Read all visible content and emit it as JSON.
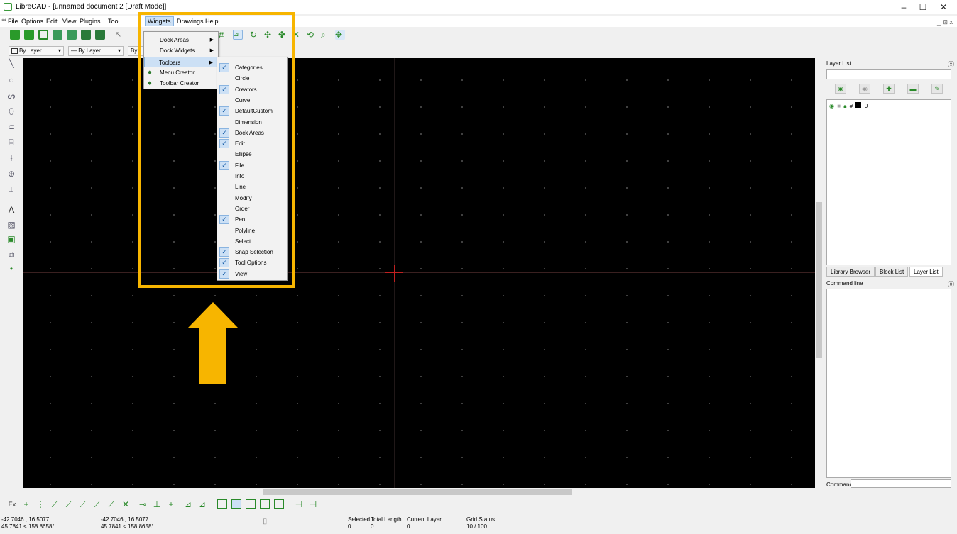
{
  "window": {
    "title": "LibreCAD - [unnamed document 2 [Draft Mode]]",
    "minimize": "–",
    "maximize": "☐",
    "close": "✕",
    "mdi_controls": "_ ⊡ x"
  },
  "menubar": {
    "items": [
      "File",
      "Options",
      "Edit",
      "View",
      "Plugins",
      "Tool",
      "Widgets",
      "Drawings",
      "Help"
    ]
  },
  "toolbar2": {
    "color_combo": "By Layer",
    "width_combo": "— By Layer",
    "type_combo": "By"
  },
  "widgets_menu": {
    "items": [
      {
        "label": "Dock Areas",
        "submenu": true
      },
      {
        "label": "Dock Widgets",
        "submenu": true
      },
      {
        "label": "Toolbars",
        "submenu": true
      },
      {
        "label": "Menu Creator",
        "submenu": false
      },
      {
        "label": "Toolbar Creator",
        "submenu": false
      }
    ]
  },
  "toolbars_menu": {
    "items": [
      {
        "label": "Categories",
        "checked": true
      },
      {
        "label": "Circle",
        "checked": false
      },
      {
        "label": "Creators",
        "checked": true
      },
      {
        "label": "Curve",
        "checked": false
      },
      {
        "label": "DefaultCustom",
        "checked": true
      },
      {
        "label": "Dimension",
        "checked": false
      },
      {
        "label": "Dock Areas",
        "checked": true
      },
      {
        "label": "Edit",
        "checked": true
      },
      {
        "label": "Ellipse",
        "checked": false
      },
      {
        "label": "File",
        "checked": true
      },
      {
        "label": "Info",
        "checked": false
      },
      {
        "label": "Line",
        "checked": false
      },
      {
        "label": "Modify",
        "checked": false
      },
      {
        "label": "Order",
        "checked": false
      },
      {
        "label": "Pen",
        "checked": true
      },
      {
        "label": "Polyline",
        "checked": false
      },
      {
        "label": "Select",
        "checked": false
      },
      {
        "label": "Snap Selection",
        "checked": true
      },
      {
        "label": "Tool Options",
        "checked": true
      },
      {
        "label": "View",
        "checked": true
      }
    ]
  },
  "right_panel": {
    "layer_list_title": "Layer List",
    "layer_row_name": "0",
    "tabs": [
      "Library Browser",
      "Block List",
      "Layer List"
    ],
    "command_line_title": "Command line",
    "command_label": "Command:"
  },
  "snap_bar": {
    "ex_label": "Ex"
  },
  "statusbar": {
    "abs_coords_1": "-42.7046 , 16.5077",
    "abs_coords_2": "45.7841 < 158.8658°",
    "rel_coords_1": "-42.7046 , 16.5077",
    "rel_coords_2": "45.7841 < 158.8658°",
    "selected_label": "Selected",
    "selected_value": "0",
    "total_length_label": "Total Length",
    "total_length_value": "0",
    "current_layer_label": "Current Layer",
    "current_layer_value": "0",
    "grid_status_label": "Grid Status",
    "grid_status_value": "10 / 100"
  },
  "colors": {
    "highlight": "#f7b500",
    "canvas": "#000000",
    "crosshair": "#c02020",
    "check_bg": "#cce0f5"
  }
}
